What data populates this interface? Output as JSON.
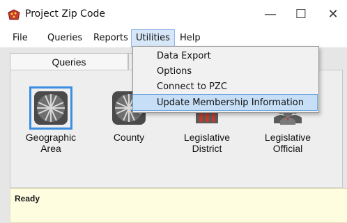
{
  "window": {
    "title": "Project Zip Code"
  },
  "controls": {
    "minimize": "—",
    "maximize": "☐",
    "close": "✕"
  },
  "menu": {
    "items": [
      "File",
      "Queries",
      "Reports",
      "Utilities",
      "Help"
    ],
    "active": "Utilities"
  },
  "dropdown": {
    "items": [
      "Data Export",
      "Options",
      "Connect to PZC",
      "Update Membership Information"
    ],
    "highlighted": "Update Membership Information"
  },
  "tabs": {
    "items": [
      "Queries"
    ]
  },
  "cards": [
    {
      "label": "Geographic\nArea",
      "icon": "grid-globe-icon",
      "selected": true
    },
    {
      "label": "County",
      "icon": "grid-globe-icon",
      "selected": false
    },
    {
      "label": "Legislative\nDistrict",
      "icon": "capitol-building-icon",
      "selected": false
    },
    {
      "label": "Legislative\nOfficial",
      "icon": "people-icon",
      "selected": false
    }
  ],
  "status": {
    "text": "Ready"
  },
  "colors": {
    "selection": "#3b8fe0",
    "status_bg": "#fffde0",
    "menu_highlight": "#c6def6"
  }
}
